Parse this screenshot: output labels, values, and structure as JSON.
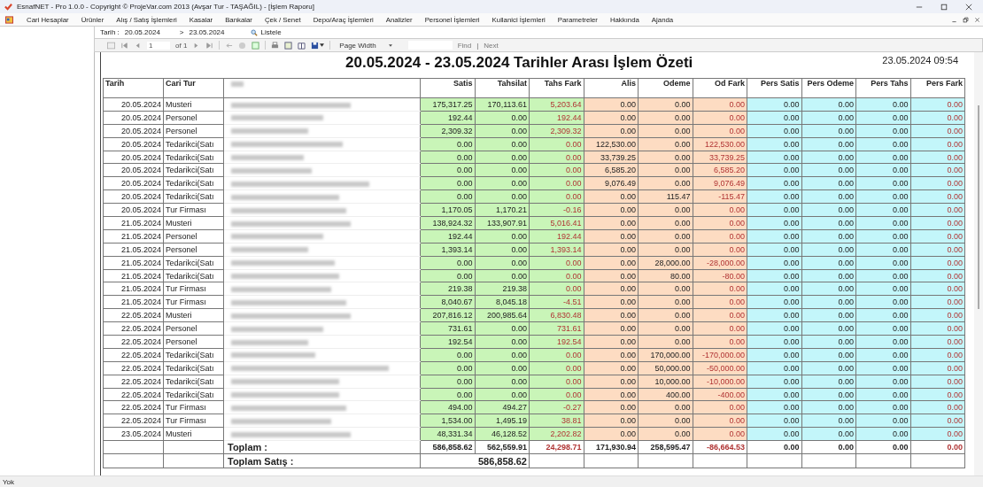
{
  "window": {
    "title": "EsnafNET - Pro 1.0.0 - Copyright ©  ProjeVar.com 2013 (Avşar Tur - TAŞAĞIL) - [İşlem Raporu]"
  },
  "menu": [
    "Cari Hesaplar",
    "Ürünler",
    "Alış / Satış İşlemleri",
    "Kasalar",
    "Bankalar",
    "Çek / Senet",
    "Depo/Araç İşlemleri",
    "Analizler",
    "Personel İşlemleri",
    "Kullanici İşlemleri",
    "Parametreler",
    "Hakkında",
    "Ajanda"
  ],
  "filter": {
    "label": "Tarih :",
    "start": "20.05.2024",
    "separator": ">",
    "end": "23.05.2024",
    "button": "Listele"
  },
  "toolbar": {
    "page": "1",
    "of": "of 1",
    "zoom": "Page Width",
    "find": "Find",
    "separator": "|",
    "next": "Next"
  },
  "report": {
    "title": "20.05.2024 - 23.05.2024 Tarihler Arası İşlem Özeti",
    "printed": "23.05.2024 09:54",
    "columns": [
      {
        "label": "Tarih",
        "kind": "info"
      },
      {
        "label": "Cari Tur",
        "kind": "info"
      },
      {
        "label": "Satis",
        "kind": "sales"
      },
      {
        "label": "Tahsilat",
        "kind": "sales"
      },
      {
        "label": "Tahs Fark",
        "kind": "salesdiff"
      },
      {
        "label": "Alis",
        "kind": "purchase"
      },
      {
        "label": "Odeme",
        "kind": "purchase"
      },
      {
        "label": "Od Fark",
        "kind": "purchasediff"
      },
      {
        "label": "Pers Satis",
        "kind": "staff"
      },
      {
        "label": "Pers Odeme",
        "kind": "staff"
      },
      {
        "label": "Pers Tahs",
        "kind": "staff"
      },
      {
        "label": "Pers Fark",
        "kind": "staffdiff"
      }
    ],
    "rows": [
      {
        "date": "20.05.2024",
        "type": "Musteri",
        "values": [
          "175,317.25",
          "170,113.61",
          "5,203.64",
          "0.00",
          "0.00",
          "0.00",
          "0.00",
          "0.00",
          "0.00",
          "0.00"
        ]
      },
      {
        "date": "20.05.2024",
        "type": "Personel",
        "values": [
          "192.44",
          "0.00",
          "192.44",
          "0.00",
          "0.00",
          "0.00",
          "0.00",
          "0.00",
          "0.00",
          "0.00"
        ]
      },
      {
        "date": "20.05.2024",
        "type": "Personel",
        "values": [
          "2,309.32",
          "0.00",
          "2,309.32",
          "0.00",
          "0.00",
          "0.00",
          "0.00",
          "0.00",
          "0.00",
          "0.00"
        ]
      },
      {
        "date": "20.05.2024",
        "type": "Tedarikci(Satı",
        "values": [
          "0.00",
          "0.00",
          "0.00",
          "122,530.00",
          "0.00",
          "122,530.00",
          "0.00",
          "0.00",
          "0.00",
          "0.00"
        ]
      },
      {
        "date": "20.05.2024",
        "type": "Tedarikci(Satı",
        "values": [
          "0.00",
          "0.00",
          "0.00",
          "33,739.25",
          "0.00",
          "33,739.25",
          "0.00",
          "0.00",
          "0.00",
          "0.00"
        ]
      },
      {
        "date": "20.05.2024",
        "type": "Tedarikci(Satı",
        "values": [
          "0.00",
          "0.00",
          "0.00",
          "6,585.20",
          "0.00",
          "6,585.20",
          "0.00",
          "0.00",
          "0.00",
          "0.00"
        ]
      },
      {
        "date": "20.05.2024",
        "type": "Tedarikci(Satı",
        "values": [
          "0.00",
          "0.00",
          "0.00",
          "9,076.49",
          "0.00",
          "9,076.49",
          "0.00",
          "0.00",
          "0.00",
          "0.00"
        ]
      },
      {
        "date": "20.05.2024",
        "type": "Tedarikci(Satı",
        "values": [
          "0.00",
          "0.00",
          "0.00",
          "0.00",
          "115.47",
          "-115.47",
          "0.00",
          "0.00",
          "0.00",
          "0.00"
        ]
      },
      {
        "date": "20.05.2024",
        "type": "Tur Firması",
        "values": [
          "1,170.05",
          "1,170.21",
          "-0.16",
          "0.00",
          "0.00",
          "0.00",
          "0.00",
          "0.00",
          "0.00",
          "0.00"
        ]
      },
      {
        "date": "21.05.2024",
        "type": "Musteri",
        "values": [
          "138,924.32",
          "133,907.91",
          "5,016.41",
          "0.00",
          "0.00",
          "0.00",
          "0.00",
          "0.00",
          "0.00",
          "0.00"
        ]
      },
      {
        "date": "21.05.2024",
        "type": "Personel",
        "values": [
          "192.44",
          "0.00",
          "192.44",
          "0.00",
          "0.00",
          "0.00",
          "0.00",
          "0.00",
          "0.00",
          "0.00"
        ]
      },
      {
        "date": "21.05.2024",
        "type": "Personel",
        "values": [
          "1,393.14",
          "0.00",
          "1,393.14",
          "0.00",
          "0.00",
          "0.00",
          "0.00",
          "0.00",
          "0.00",
          "0.00"
        ]
      },
      {
        "date": "21.05.2024",
        "type": "Tedarikci(Satı",
        "values": [
          "0.00",
          "0.00",
          "0.00",
          "0.00",
          "28,000.00",
          "-28,000.00",
          "0.00",
          "0.00",
          "0.00",
          "0.00"
        ]
      },
      {
        "date": "21.05.2024",
        "type": "Tedarikci(Satı",
        "values": [
          "0.00",
          "0.00",
          "0.00",
          "0.00",
          "80.00",
          "-80.00",
          "0.00",
          "0.00",
          "0.00",
          "0.00"
        ]
      },
      {
        "date": "21.05.2024",
        "type": "Tur Firması",
        "values": [
          "219.38",
          "219.38",
          "0.00",
          "0.00",
          "0.00",
          "0.00",
          "0.00",
          "0.00",
          "0.00",
          "0.00"
        ]
      },
      {
        "date": "21.05.2024",
        "type": "Tur Firması",
        "values": [
          "8,040.67",
          "8,045.18",
          "-4.51",
          "0.00",
          "0.00",
          "0.00",
          "0.00",
          "0.00",
          "0.00",
          "0.00"
        ]
      },
      {
        "date": "22.05.2024",
        "type": "Musteri",
        "values": [
          "207,816.12",
          "200,985.64",
          "6,830.48",
          "0.00",
          "0.00",
          "0.00",
          "0.00",
          "0.00",
          "0.00",
          "0.00"
        ]
      },
      {
        "date": "22.05.2024",
        "type": "Personel",
        "values": [
          "731.61",
          "0.00",
          "731.61",
          "0.00",
          "0.00",
          "0.00",
          "0.00",
          "0.00",
          "0.00",
          "0.00"
        ]
      },
      {
        "date": "22.05.2024",
        "type": "Personel",
        "values": [
          "192.54",
          "0.00",
          "192.54",
          "0.00",
          "0.00",
          "0.00",
          "0.00",
          "0.00",
          "0.00",
          "0.00"
        ]
      },
      {
        "date": "22.05.2024",
        "type": "Tedarikci(Satı",
        "values": [
          "0.00",
          "0.00",
          "0.00",
          "0.00",
          "170,000.00",
          "-170,000.00",
          "0.00",
          "0.00",
          "0.00",
          "0.00"
        ]
      },
      {
        "date": "22.05.2024",
        "type": "Tedarikci(Satı",
        "values": [
          "0.00",
          "0.00",
          "0.00",
          "0.00",
          "50,000.00",
          "-50,000.00",
          "0.00",
          "0.00",
          "0.00",
          "0.00"
        ]
      },
      {
        "date": "22.05.2024",
        "type": "Tedarikci(Satı",
        "values": [
          "0.00",
          "0.00",
          "0.00",
          "0.00",
          "10,000.00",
          "-10,000.00",
          "0.00",
          "0.00",
          "0.00",
          "0.00"
        ]
      },
      {
        "date": "22.05.2024",
        "type": "Tedarikci(Satı",
        "values": [
          "0.00",
          "0.00",
          "0.00",
          "0.00",
          "400.00",
          "-400.00",
          "0.00",
          "0.00",
          "0.00",
          "0.00"
        ]
      },
      {
        "date": "22.05.2024",
        "type": "Tur Firması",
        "values": [
          "494.00",
          "494.27",
          "-0.27",
          "0.00",
          "0.00",
          "0.00",
          "0.00",
          "0.00",
          "0.00",
          "0.00"
        ]
      },
      {
        "date": "22.05.2024",
        "type": "Tur Firması",
        "values": [
          "1,534.00",
          "1,495.19",
          "38.81",
          "0.00",
          "0.00",
          "0.00",
          "0.00",
          "0.00",
          "0.00",
          "0.00"
        ]
      },
      {
        "date": "23.05.2024",
        "type": "Musteri",
        "values": [
          "48,331.34",
          "46,128.52",
          "2,202.82",
          "0.00",
          "0.00",
          "0.00",
          "0.00",
          "0.00",
          "0.00",
          "0.00"
        ]
      }
    ],
    "total": {
      "label": "Toplam :",
      "values": [
        "586,858.62",
        "562,559.91",
        "24,298.71",
        "171,930.94",
        "258,595.47",
        "-86,664.53",
        "0.00",
        "0.00",
        "0.00",
        "0.00"
      ]
    },
    "sales_total": {
      "label": "Toplam Satış :",
      "value": "586,858.62"
    }
  },
  "status_bar": "Yok"
}
